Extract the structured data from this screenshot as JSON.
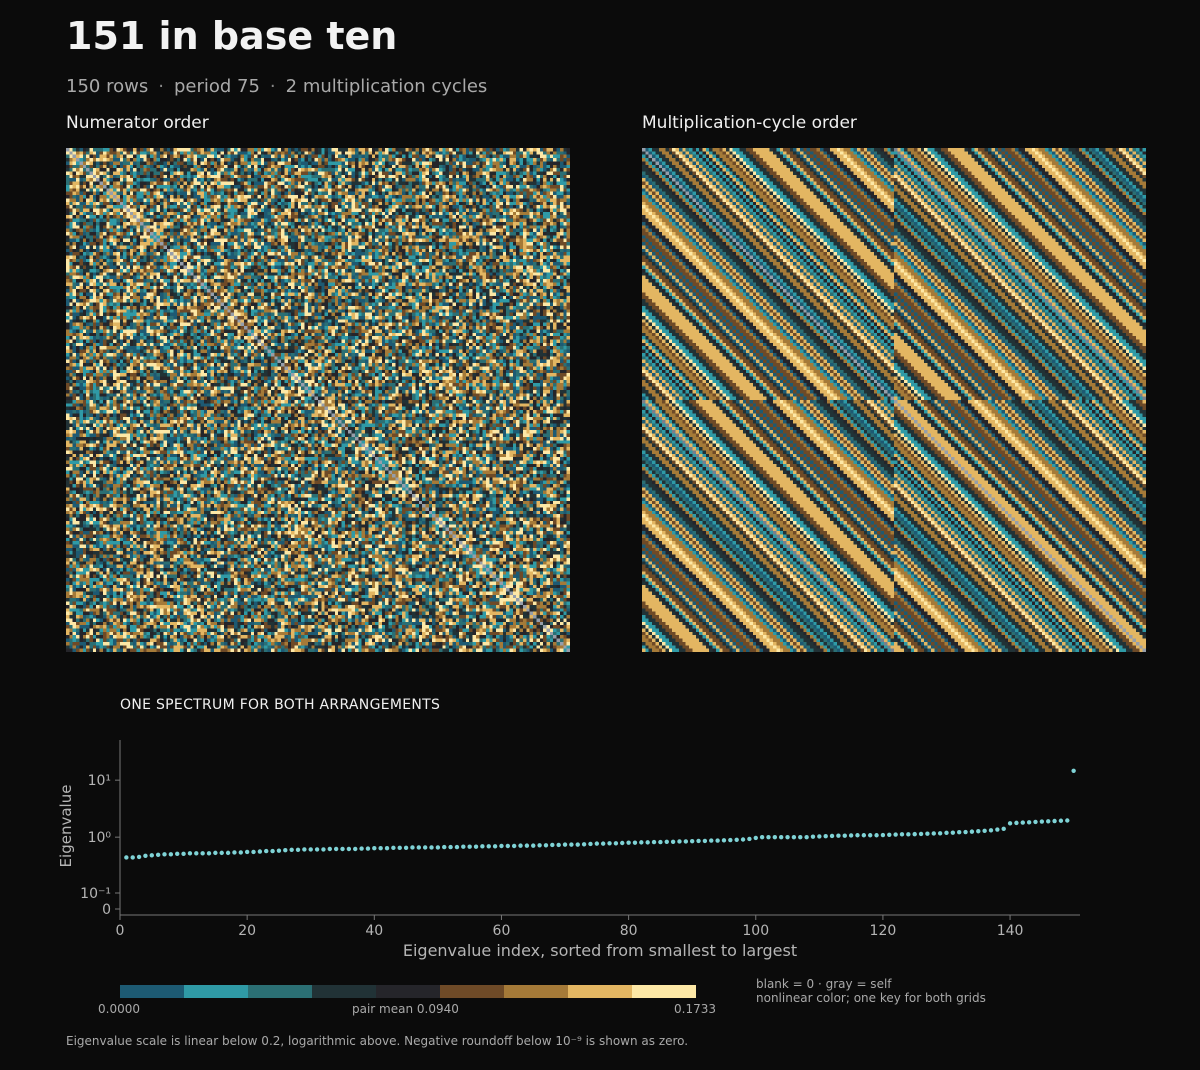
{
  "header": {
    "title": "151 in base ten",
    "subtitle_parts": [
      "150 rows",
      "period 75",
      "2 multiplication cycles"
    ],
    "separator": "·"
  },
  "panels": {
    "left_title": "Numerator order",
    "right_title": "Multiplication-cycle order"
  },
  "legend": {
    "min_label": "0.0000",
    "mid_label": "pair mean 0.0940",
    "max_label": "0.1733",
    "note_line1": "blank = 0 · gray = self",
    "note_line2": "nonlinear color; one key for both grids",
    "colors": [
      "#1d5a73",
      "#2f9aa6",
      "#2b6f74",
      "#213236",
      "#25252a",
      "#6e4a27",
      "#a57a38",
      "#e3b662",
      "#fde8a6"
    ]
  },
  "footnote": "Eigenvalue scale is linear below 0.2, logarithmic above. Negative roundoff below 10⁻⁹ is shown as zero.",
  "chart_data": [
    {
      "type": "heatmap",
      "title": "Numerator order",
      "rows": 150,
      "cols": 150,
      "value_range": [
        0.0,
        0.1733
      ],
      "pattern": "noisy with diagonal blocks"
    },
    {
      "type": "heatmap",
      "title": "Multiplication-cycle order",
      "rows": 150,
      "cols": 150,
      "value_range": [
        0.0,
        0.1733
      ],
      "pattern": "2×2 blocks of diagonal stripes"
    },
    {
      "type": "scatter",
      "title": "ONE SPECTRUM FOR BOTH ARRANGEMENTS",
      "xlabel": "Eigenvalue index, sorted from smallest to largest",
      "ylabel": "Eigenvalue",
      "x_ticks": [
        "0",
        "20",
        "40",
        "60",
        "80",
        "100",
        "120",
        "140"
      ],
      "y_ticks": [
        "0",
        "10⁻¹",
        "10⁰",
        "10¹"
      ],
      "x": [
        1,
        2,
        3,
        4,
        5,
        6,
        7,
        8,
        9,
        10,
        11,
        12,
        13,
        14,
        15,
        16,
        17,
        18,
        19,
        20,
        21,
        22,
        23,
        24,
        25,
        26,
        27,
        28,
        29,
        30,
        31,
        32,
        33,
        34,
        35,
        36,
        37,
        38,
        39,
        40,
        41,
        42,
        43,
        44,
        45,
        46,
        47,
        48,
        49,
        50,
        51,
        52,
        53,
        54,
        55,
        56,
        57,
        58,
        59,
        60,
        61,
        62,
        63,
        64,
        65,
        66,
        67,
        68,
        69,
        70,
        71,
        72,
        73,
        74,
        75,
        76,
        77,
        78,
        79,
        80,
        81,
        82,
        83,
        84,
        85,
        86,
        87,
        88,
        89,
        90,
        91,
        92,
        93,
        94,
        95,
        96,
        97,
        98,
        99,
        100,
        101,
        102,
        103,
        104,
        105,
        106,
        107,
        108,
        109,
        110,
        111,
        112,
        113,
        114,
        115,
        116,
        117,
        118,
        119,
        120,
        121,
        122,
        123,
        124,
        125,
        126,
        127,
        128,
        129,
        130,
        131,
        132,
        133,
        134,
        135,
        136,
        137,
        138,
        139,
        140,
        141,
        142,
        143,
        144,
        145,
        146,
        147,
        148,
        149,
        150
      ],
      "y": [
        0.44,
        0.44,
        0.45,
        0.47,
        0.48,
        0.49,
        0.5,
        0.5,
        0.51,
        0.51,
        0.52,
        0.52,
        0.52,
        0.52,
        0.53,
        0.53,
        0.53,
        0.54,
        0.54,
        0.55,
        0.55,
        0.56,
        0.57,
        0.57,
        0.58,
        0.59,
        0.6,
        0.6,
        0.61,
        0.61,
        0.61,
        0.61,
        0.62,
        0.62,
        0.62,
        0.62,
        0.62,
        0.63,
        0.63,
        0.64,
        0.64,
        0.64,
        0.65,
        0.65,
        0.65,
        0.66,
        0.66,
        0.66,
        0.66,
        0.66,
        0.67,
        0.67,
        0.67,
        0.68,
        0.68,
        0.68,
        0.69,
        0.69,
        0.69,
        0.7,
        0.7,
        0.7,
        0.71,
        0.71,
        0.71,
        0.72,
        0.72,
        0.73,
        0.73,
        0.74,
        0.74,
        0.74,
        0.75,
        0.76,
        0.77,
        0.77,
        0.78,
        0.78,
        0.79,
        0.8,
        0.8,
        0.81,
        0.81,
        0.82,
        0.82,
        0.83,
        0.83,
        0.84,
        0.84,
        0.85,
        0.86,
        0.86,
        0.87,
        0.87,
        0.88,
        0.89,
        0.9,
        0.91,
        0.93,
        0.97,
        1.0,
        1.0,
        1.0,
        1.0,
        1.0,
        1.0,
        1.0,
        1.0,
        1.02,
        1.03,
        1.04,
        1.05,
        1.06,
        1.06,
        1.07,
        1.08,
        1.08,
        1.08,
        1.08,
        1.09,
        1.1,
        1.11,
        1.12,
        1.12,
        1.13,
        1.14,
        1.15,
        1.16,
        1.17,
        1.19,
        1.2,
        1.22,
        1.23,
        1.25,
        1.27,
        1.29,
        1.32,
        1.36,
        1.4,
        1.75,
        1.78,
        1.8,
        1.82,
        1.85,
        1.88,
        1.9,
        1.92,
        1.94,
        1.96,
        14.6
      ],
      "yscale": "linear below 0.2, logarithmic above"
    }
  ]
}
